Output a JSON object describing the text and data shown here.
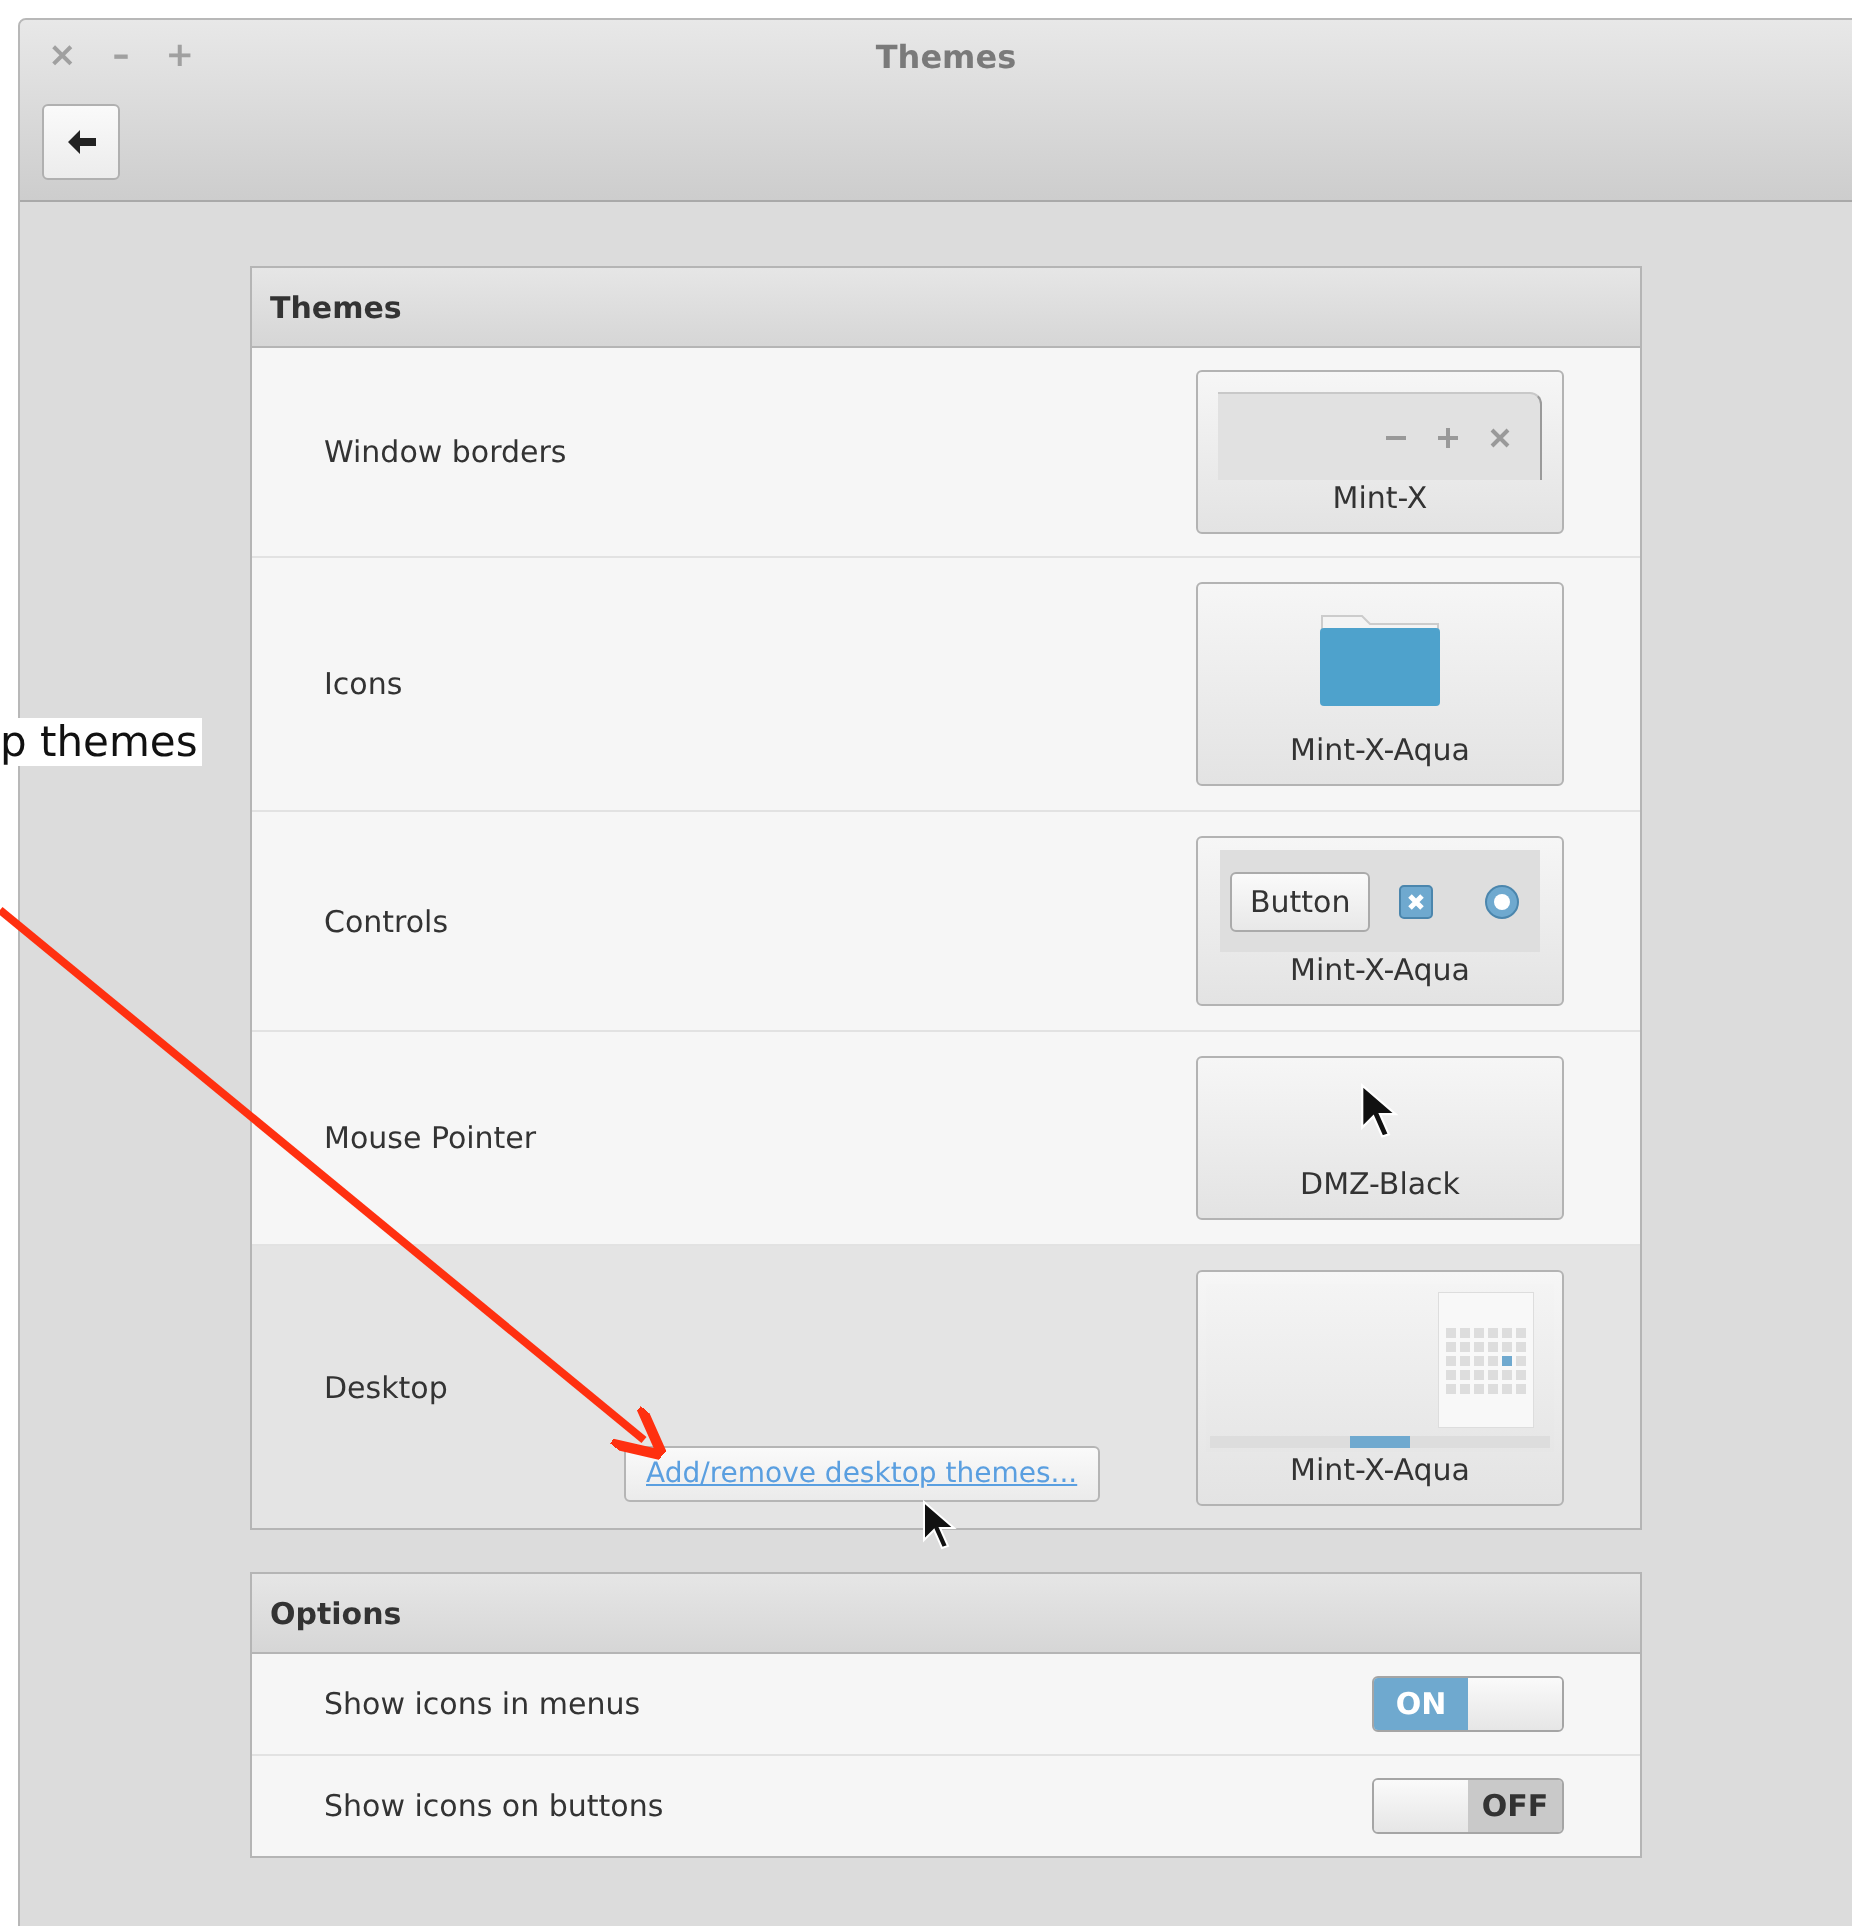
{
  "annotation": {
    "text": "p themes"
  },
  "window": {
    "title": "Themes",
    "controls": [
      {
        "glyph": "×"
      },
      {
        "glyph": "–"
      },
      {
        "glyph": "+"
      }
    ]
  },
  "themes": {
    "header": "Themes",
    "rows": [
      {
        "label": "Window borders",
        "kind": "borders",
        "theme": "Mint-X",
        "highlighted": false
      },
      {
        "label": "Icons",
        "kind": "icons",
        "theme": "Mint-X-Aqua",
        "highlighted": false
      },
      {
        "label": "Controls",
        "kind": "controls",
        "theme": "Mint-X-Aqua",
        "sample_button": "Button",
        "highlighted": false
      },
      {
        "label": "Mouse Pointer",
        "kind": "pointer",
        "theme": "DMZ-Black",
        "highlighted": false
      },
      {
        "label": "Desktop",
        "kind": "desktop",
        "theme": "Mint-X-Aqua",
        "link": "Add/remove desktop themes...",
        "highlighted": true
      }
    ]
  },
  "options": {
    "header": "Options",
    "rows": [
      {
        "label": "Show icons in menus",
        "on": true,
        "on_text": "ON"
      },
      {
        "label": "Show icons on buttons",
        "on": false,
        "off_text": "OFF"
      }
    ]
  }
}
